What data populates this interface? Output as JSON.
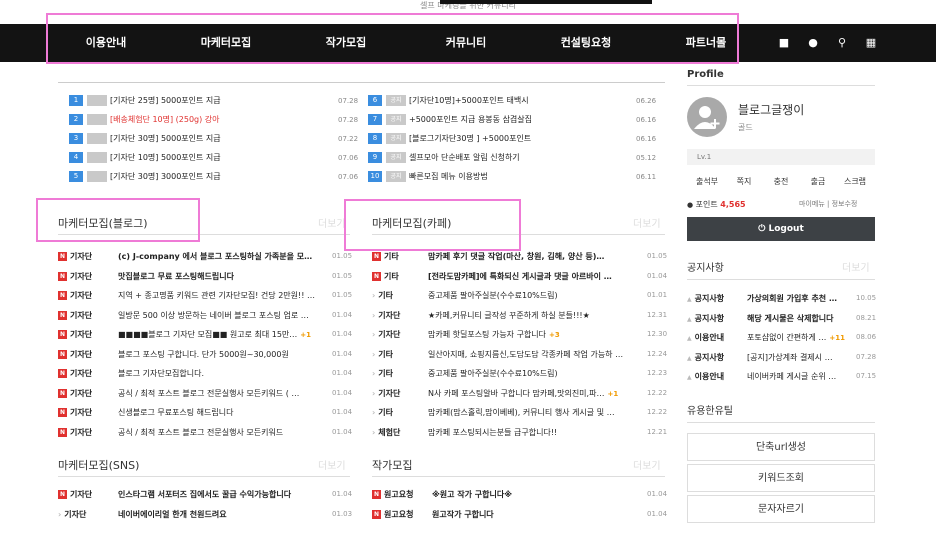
{
  "header": {
    "tagline": "셀프 마케팅을 위한 커뮤니티"
  },
  "nav": {
    "items": [
      "이용안내",
      "마케터모집",
      "작가모집",
      "커뮤니티",
      "컨설팅요청",
      "파트너몰"
    ]
  },
  "icons": [
    "bag-icon",
    "bell-icon",
    "search-icon",
    "grid-icon"
  ],
  "notices_left": [
    {
      "num": "1",
      "title": "[기자단 25명] 5000포인트 지급",
      "date": "07.28",
      "red": false
    },
    {
      "num": "2",
      "title": "[배송체험단 10명] (250g) 강아",
      "date": "07.28",
      "red": true
    },
    {
      "num": "3",
      "title": "[기자단 30명] 5000포인트 지급",
      "date": "07.22",
      "red": false
    },
    {
      "num": "4",
      "title": "[기자단 10명] 5000포인트 지급",
      "date": "07.06",
      "red": false
    },
    {
      "num": "5",
      "title": "[기자단 30명] 3000포인트 지급",
      "date": "07.06",
      "red": false
    }
  ],
  "notices_right": [
    {
      "num": "6",
      "badge": "공지",
      "title": "[기자단10명]+5000포인트 태백시",
      "date": "06.26"
    },
    {
      "num": "7",
      "badge": "공지",
      "title": "+5000포인트 지급 용봉동 삼겹살집",
      "date": "06.16"
    },
    {
      "num": "8",
      "badge": "공지",
      "title": "[블로그기자단30명 ] +5000포인트",
      "date": "06.16"
    },
    {
      "num": "9",
      "badge": "공지",
      "title": "셀프모아 단순배포 알림 신청하기",
      "date": "05.12"
    },
    {
      "num": "10",
      "badge": "공지",
      "title": "빠른모집 메뉴 이용방법",
      "date": "06.11"
    }
  ],
  "blog": {
    "title": "마케터모집(블로그)",
    "more": "더보기",
    "rows": [
      {
        "cat": "기자단",
        "title": "(c) J-company 에서 블로그 포스팅하실 가족분을 모…",
        "date": "01.05",
        "bold": true,
        "comments": ""
      },
      {
        "cat": "기자단",
        "title": "맛집블로그 무료 포스팅해드립니다",
        "date": "01.05",
        "bold": true,
        "comments": ""
      },
      {
        "cat": "기자단",
        "title": "지역 + 종고명품 키워드 관련 기자단모집! 건당 2만원!! …",
        "date": "01.05",
        "bold": false,
        "comments": ""
      },
      {
        "cat": "기자단",
        "title": "일방문 500 이상 방문하는 네이버 블로그 포스팅 업로 …",
        "date": "01.04",
        "bold": false,
        "comments": ""
      },
      {
        "cat": "기자단",
        "title": "■■■■블로그 기자단 모집■■ 원고로 최대 15만…",
        "date": "01.04",
        "bold": false,
        "comments": "+1"
      },
      {
        "cat": "기자단",
        "title": "블로그 포스팅 구합니다. 단가 5000원~30,000원",
        "date": "01.04",
        "bold": false,
        "comments": ""
      },
      {
        "cat": "기자단",
        "title": "블로그 기자단모집합니다.",
        "date": "01.04",
        "bold": false,
        "comments": ""
      },
      {
        "cat": "기자단",
        "title": "공식 / 최적 포스트 블로그 전문실행사 모든키워드 ( …",
        "date": "01.04",
        "bold": false,
        "comments": ""
      },
      {
        "cat": "기자단",
        "title": "신생블로그 무료포스팅 해드립니다",
        "date": "01.04",
        "bold": false,
        "comments": ""
      },
      {
        "cat": "기자단",
        "title": "공식 / 최적 포스트 블로그 전문실행사 모든키워드",
        "date": "01.04",
        "bold": false,
        "comments": ""
      }
    ]
  },
  "cafe": {
    "title": "마케터모집(카페)",
    "more": "더보기",
    "rows": [
      {
        "cat": "기타",
        "title": "맘카페 후기 댓글 작업(마산, 창원, 김해, 양산 등)…",
        "date": "01.05",
        "bold": true,
        "new": true,
        "comments": ""
      },
      {
        "cat": "기타",
        "title": "[전라도맘카페]에 특화되신 게시글과 댓글 아르바이 …",
        "date": "01.04",
        "bold": true,
        "new": true,
        "comments": ""
      },
      {
        "cat": "기타",
        "title": "중고제품 팔아주실분(수수료10%드림)",
        "date": "01.01",
        "bold": false,
        "new": false,
        "comments": ""
      },
      {
        "cat": "기자단",
        "title": "★카페,커뮤니티 글작성 꾸준하게 하실 분들!!!★",
        "date": "12.31",
        "bold": false,
        "new": false,
        "comments": ""
      },
      {
        "cat": "기자단",
        "title": "맘카페 핫딜포스팅 가능자 구합니다",
        "date": "12.30",
        "bold": false,
        "new": false,
        "comments": "+3"
      },
      {
        "cat": "기타",
        "title": "일산아지매, 쇼핑지름신,도담도담 각종카페 작업 가능하 …",
        "date": "12.24",
        "bold": false,
        "new": false,
        "comments": ""
      },
      {
        "cat": "기타",
        "title": "중고제품 팔아주실분(수수료10%드림)",
        "date": "12.23",
        "bold": false,
        "new": false,
        "comments": ""
      },
      {
        "cat": "기자단",
        "title": "N사 카페 포스팅알바 구합니다 맘카페,맛의진미,파…",
        "date": "12.22",
        "bold": false,
        "new": false,
        "comments": "+1"
      },
      {
        "cat": "기타",
        "title": "맘카페(맘스홀릭,맘이베베), 커뮤니티 행사 게시글 및 …",
        "date": "12.22",
        "bold": false,
        "new": false,
        "comments": ""
      },
      {
        "cat": "체험단",
        "title": "맘카페 포스팅되시는분들 급구합니다!!",
        "date": "12.21",
        "bold": false,
        "new": false,
        "comments": ""
      }
    ]
  },
  "sns": {
    "title": "마케터모집(SNS)",
    "more": "더보기",
    "rows": [
      {
        "cat": "기자단",
        "title": "인스타그램 서포터즈 집에서도 꿀급 수익가능합니다",
        "date": "01.04",
        "bold": true,
        "new": true
      },
      {
        "cat": "기자단",
        "title": "네이버에이리얼 한개 천원드려요",
        "date": "01.03",
        "bold": true,
        "new": false
      }
    ]
  },
  "writer": {
    "title": "작가모집",
    "more": "더보기",
    "rows": [
      {
        "cat": "원고요청",
        "title": "※원고 작가 구합니다※",
        "date": "01.04",
        "bold": true
      },
      {
        "cat": "원고요청",
        "title": "원고작가 구합니다",
        "date": "01.04",
        "bold": true
      }
    ]
  },
  "profile": {
    "heading": "Profile",
    "name": "블로그글쟁이",
    "grade": "골드",
    "level": "Lv.1",
    "menu": [
      "출석부",
      "쪽지",
      "충전",
      "출금",
      "스크랩"
    ],
    "point_label": "포인트",
    "point_value": "4,565",
    "links": [
      "마이메뉴",
      "정보수정"
    ],
    "logout": "Logout"
  },
  "notice_side": {
    "title": "공지사항",
    "more": "더보기",
    "rows": [
      {
        "cat": "공지사항",
        "title": "가상의회원 가입후 추천 …",
        "date": "10.05",
        "bold": true,
        "comments": ""
      },
      {
        "cat": "공지사항",
        "title": "해당 게시물은 삭제합니다",
        "date": "08.21",
        "bold": true,
        "comments": ""
      },
      {
        "cat": "이용안내",
        "title": "포토샵없이 간편하게 …",
        "date": "08.06",
        "bold": false,
        "comments": "+11"
      },
      {
        "cat": "공지사항",
        "title": "[공지]가상계좌 결제시 …",
        "date": "07.28",
        "bold": false,
        "comments": ""
      },
      {
        "cat": "이용안내",
        "title": "네이버카페 게시글 순위 …",
        "date": "07.15",
        "bold": false,
        "comments": ""
      }
    ]
  },
  "tools": {
    "title": "유용한유틸",
    "buttons": [
      "단축url생성",
      "키워드조회",
      "문자자르기"
    ]
  }
}
